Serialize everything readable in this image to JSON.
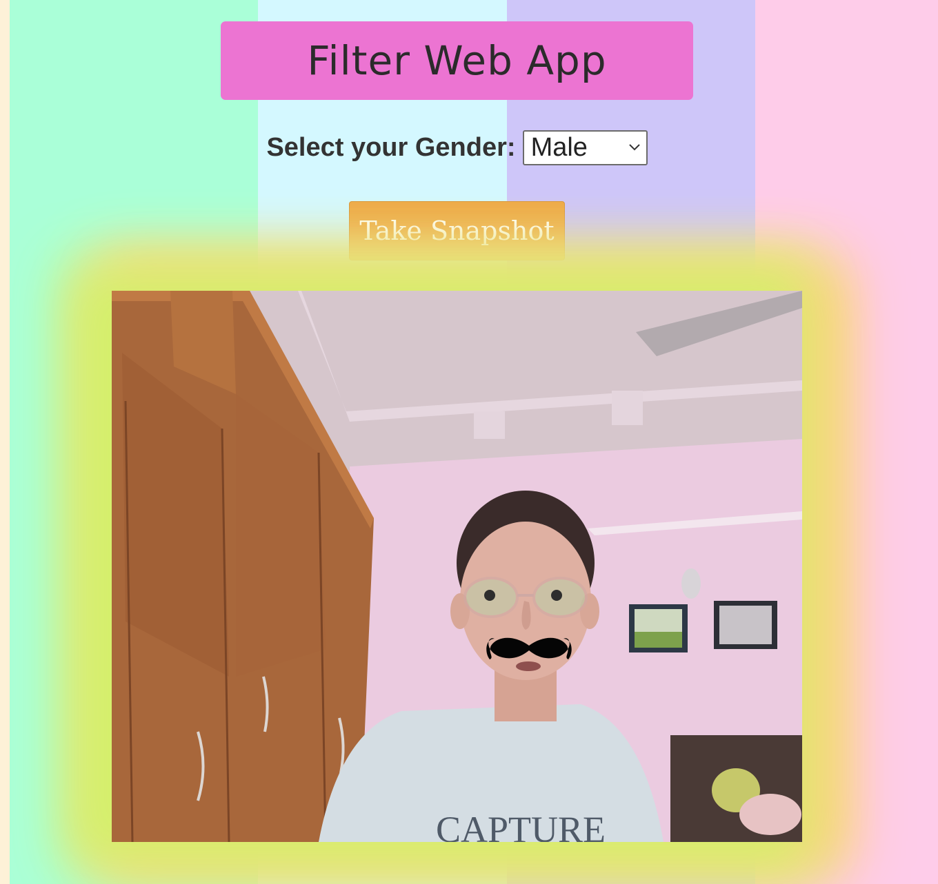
{
  "app": {
    "title": "Filter Web App"
  },
  "gender": {
    "label": "Select your Gender:",
    "selected": "Male"
  },
  "snapshot_button": {
    "label": "Take Snapshot"
  },
  "colors": {
    "title_bg": "#ec74d2",
    "button_bg": "#eeaa48",
    "stripe_1": "#aaffd8",
    "stripe_2": "#d4f8ff",
    "stripe_3": "#cec6f9",
    "stripe_4": "#fecce9"
  },
  "video": {
    "filter_icon": "mustache-overlay"
  }
}
